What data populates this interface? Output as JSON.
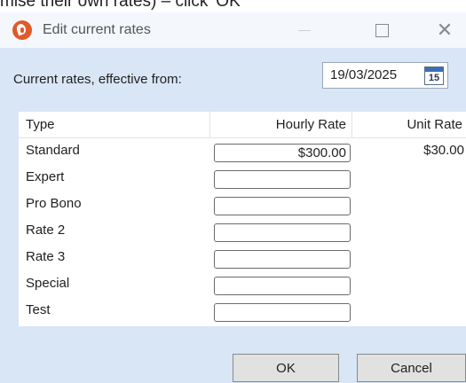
{
  "caption": "mise their own rates) – click 'OK'",
  "window": {
    "title": "Edit current rates",
    "minimize_icon": "minimize-icon",
    "maximize_icon": "maximize-icon",
    "close_icon": "close-icon",
    "close_glyph": "✕"
  },
  "rates": {
    "label": "Current rates, effective from:",
    "date": "19/03/2025",
    "calendar_day": "15"
  },
  "table": {
    "headers": {
      "type": "Type",
      "hourly": "Hourly Rate",
      "unit": "Unit Rate"
    },
    "rows": [
      {
        "type": "Standard",
        "hourly": "$300.00",
        "unit": "$30.00"
      },
      {
        "type": "Expert",
        "hourly": "",
        "unit": ""
      },
      {
        "type": "Pro Bono",
        "hourly": "",
        "unit": ""
      },
      {
        "type": "Rate 2",
        "hourly": "",
        "unit": ""
      },
      {
        "type": "Rate 3",
        "hourly": "",
        "unit": ""
      },
      {
        "type": "Special",
        "hourly": "",
        "unit": ""
      },
      {
        "type": "Test",
        "hourly": "",
        "unit": ""
      }
    ]
  },
  "buttons": {
    "ok": "OK",
    "cancel": "Cancel"
  }
}
